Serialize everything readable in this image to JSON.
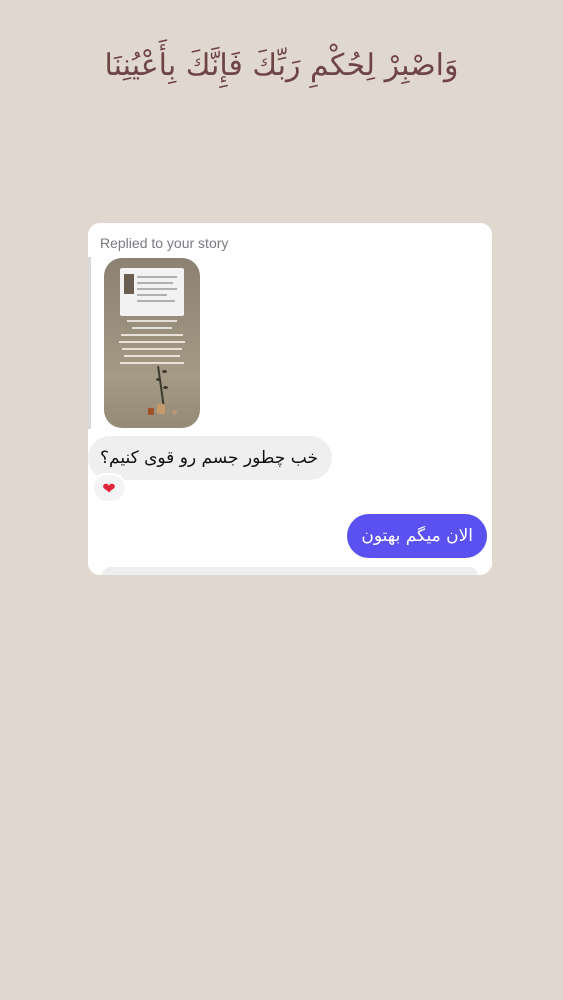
{
  "header": {
    "verse": "وَاصْبِرْ لِحُكْمِ رَبِّكَ فَإِنَّكَ بِأَعْيُنِنَا"
  },
  "chat": {
    "reply_context": "Replied to your story",
    "messages": [
      {
        "side": "received",
        "text": "خب چطور جسم رو قوی کنیم؟"
      },
      {
        "side": "sent",
        "text": "الان میگم بهتون"
      }
    ],
    "reaction": "❤"
  },
  "colors": {
    "background": "#e0d8ce",
    "verse": "#6e4446",
    "sent_bubble": "#5b50f0",
    "received_bubble": "#efefef",
    "reaction": "#e0243a"
  },
  "icons": {
    "reaction": "heart-icon"
  }
}
